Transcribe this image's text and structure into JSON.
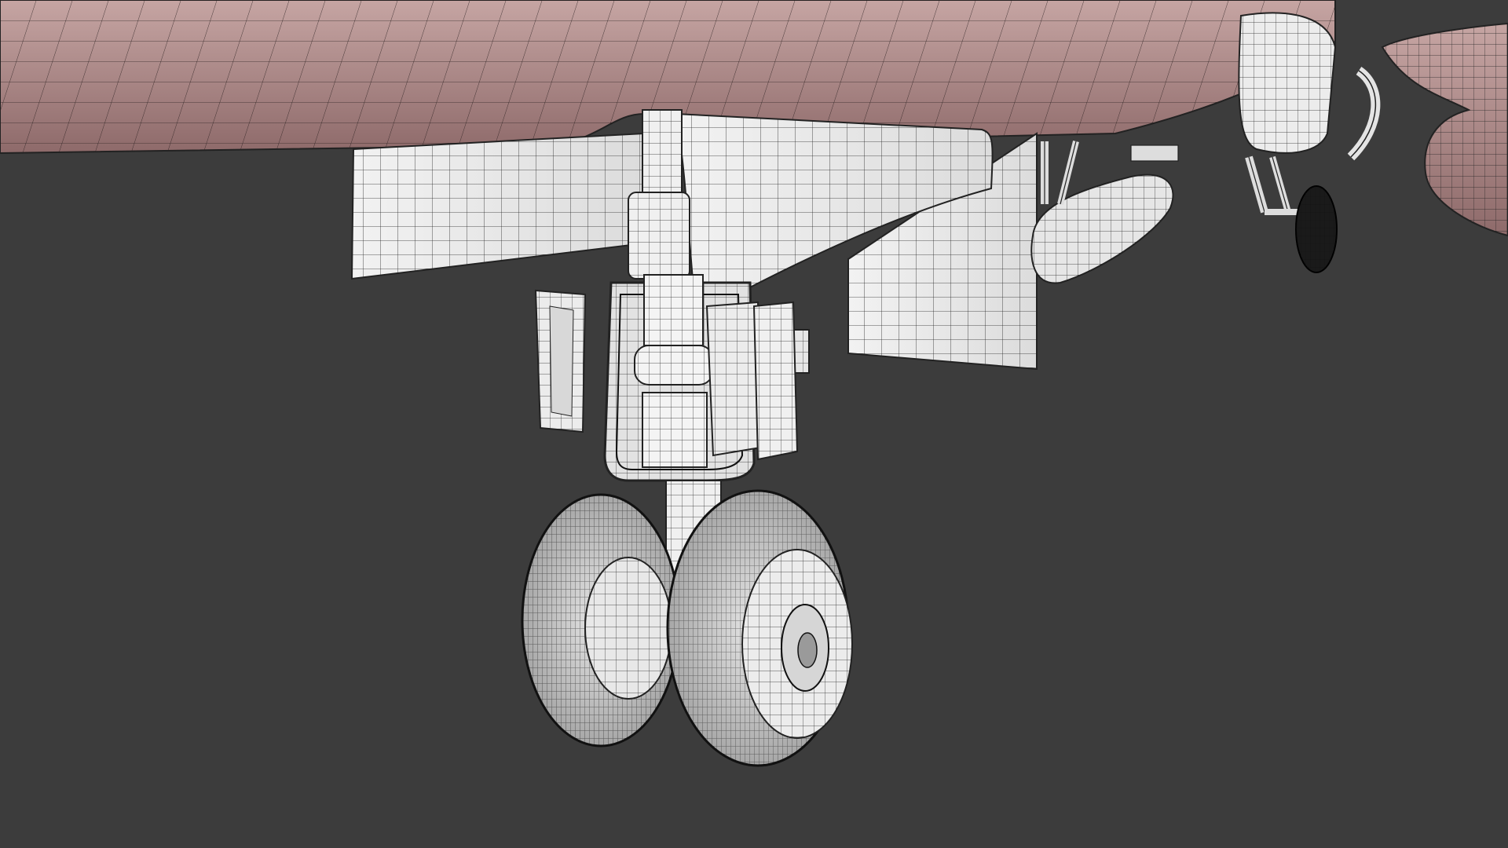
{
  "scene": {
    "background_color": "#3c3c3c",
    "fuselage_color": "#b89594",
    "fuselage_shade_color": "#8a6767",
    "body_color": "#eeeeee",
    "wire_color": "#222222",
    "tire_color": "#cfcfcf",
    "objects": [
      "fuselage-underside",
      "landing-gear-bay-doors",
      "nose-landing-gear-strut",
      "twin-nose-wheels",
      "external-fuel-tank",
      "main-landing-gear",
      "wing-pylon"
    ]
  }
}
